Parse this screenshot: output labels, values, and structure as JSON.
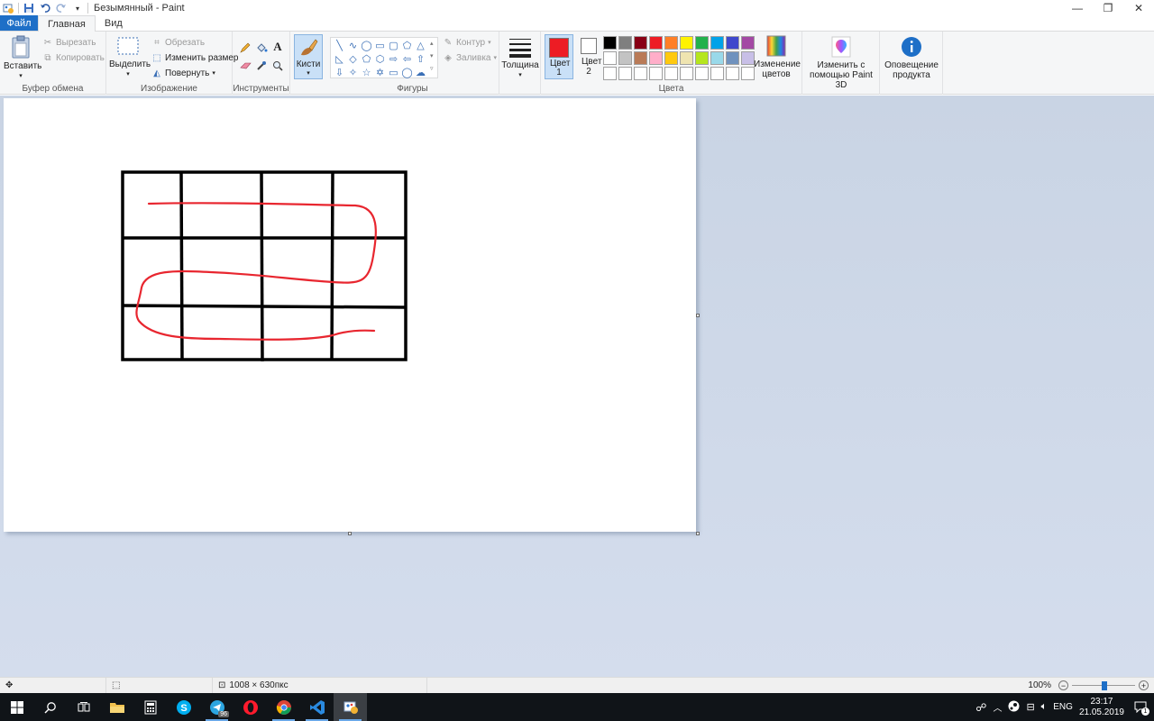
{
  "window": {
    "title": "Безымянный - Paint",
    "controls": [
      "—",
      "❐",
      "✕"
    ]
  },
  "tabs": [
    {
      "label": "Файл"
    },
    {
      "label": "Главная"
    },
    {
      "label": "Вид"
    }
  ],
  "ribbon": {
    "clipboard": {
      "group_label": "Буфер обмена",
      "paste": "Вставить",
      "cut": "Вырезать",
      "copy": "Копировать"
    },
    "image": {
      "group_label": "Изображение",
      "select": "Выделить",
      "crop": "Обрезать",
      "resize": "Изменить размер",
      "rotate": "Повернуть"
    },
    "tools": {
      "group_label": "Инструменты",
      "text_glyph": "A"
    },
    "brushes": {
      "label": "Кисти"
    },
    "shapes": {
      "group_label": "Фигуры",
      "outline": "Контур",
      "fill": "Заливка"
    },
    "size": {
      "label": "Толщина"
    },
    "colors": {
      "group_label": "Цвета",
      "color1": "Цвет 1",
      "color2": "Цвет 2",
      "color1_value": "#ed1c24",
      "color2_value": "#ffffff",
      "edit_colors": "Изменение цветов",
      "palette": [
        "#000000",
        "#7f7f7f",
        "#880015",
        "#ed1c24",
        "#ff7f27",
        "#fff200",
        "#22b14c",
        "#00a2e8",
        "#3f48cc",
        "#a349a4",
        "#ffffff",
        "#c3c3c3",
        "#b97a57",
        "#ffaec9",
        "#ffc90e",
        "#efe4b0",
        "#b5e61d",
        "#99d9ea",
        "#7092be",
        "#c8bfe7",
        "#ffffff",
        "#ffffff",
        "#ffffff",
        "#ffffff",
        "#ffffff",
        "#ffffff",
        "#ffffff",
        "#ffffff",
        "#ffffff",
        "#ffffff"
      ]
    },
    "paint3d": "Изменить с помощью Paint 3D",
    "notice": "Оповещение продукта"
  },
  "status": {
    "dimensions": "1008 × 630пкс",
    "zoom": "100%"
  },
  "taskbar": {
    "lang": "ENG",
    "time": "23:17",
    "date": "21.05.2019",
    "telegram_badge": "96",
    "notifications": "1"
  }
}
